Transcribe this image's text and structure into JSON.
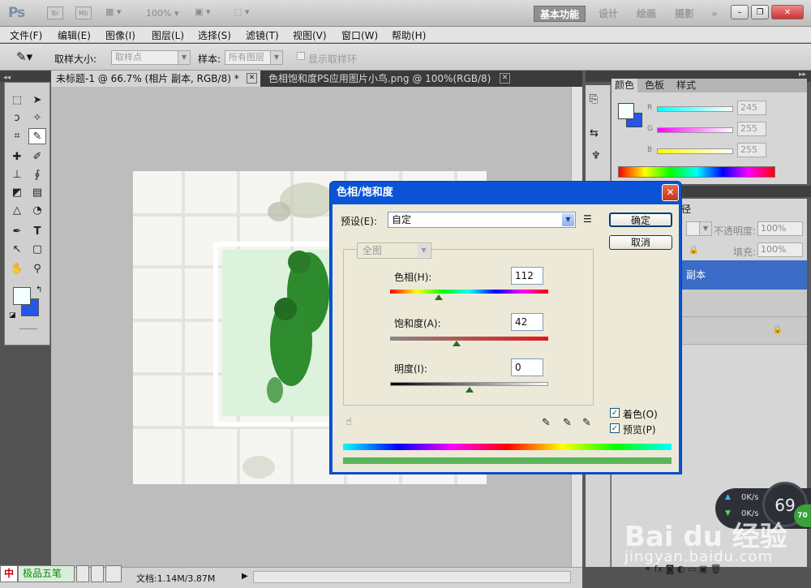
{
  "app": {
    "logo": "Ps"
  },
  "titlebar": {
    "zoom": "100%",
    "workspaces": [
      "基本功能",
      "设计",
      "绘画",
      "摄影"
    ],
    "more": "»",
    "small_icons": [
      "Br",
      "Mb"
    ]
  },
  "menu": [
    "文件(F)",
    "编辑(E)",
    "图像(I)",
    "图层(L)",
    "选择(S)",
    "滤镜(T)",
    "视图(V)",
    "窗口(W)",
    "帮助(H)"
  ],
  "options": {
    "sample_size_label": "取样大小:",
    "sample_size_value": "取样点",
    "sample_label": "样本:",
    "sample_value": "所有图层",
    "show_ring": "显示取样环"
  },
  "tabs": [
    {
      "label": "未标题-1 @ 66.7% (相片 副本, RGB/8) *",
      "active": true
    },
    {
      "label": "色相饱和度PS应用图片小鸟.png @ 100%(RGB/8)",
      "active": false
    }
  ],
  "color_panel": {
    "tabs": [
      "颜色",
      "色板",
      "样式"
    ],
    "channels": [
      {
        "name": "R",
        "value": "245"
      },
      {
        "name": "G",
        "value": "255"
      },
      {
        "name": "B",
        "value": "255"
      }
    ]
  },
  "layers_panel": {
    "opacity_label": "不透明度:",
    "opacity_value": "100%",
    "fill_label": "填充:",
    "fill_value": "100%",
    "layer_name": "副本",
    "tab_fragment": "径"
  },
  "dialog": {
    "title": "色相/饱和度",
    "preset_label": "预设(E):",
    "preset_value": "自定",
    "channel_value": "全图",
    "ok": "确定",
    "cancel": "取消",
    "hue_label": "色相(H):",
    "hue_value": "112",
    "saturation_label": "饱和度(A):",
    "saturation_value": "42",
    "lightness_label": "明度(I):",
    "lightness_value": "0",
    "colorize_label": "着色(O)",
    "preview_label": "预览(P)",
    "hue_pos": 0.31,
    "sat_pos": 0.42,
    "light_pos": 0.5
  },
  "status": {
    "doc_info": "文档:1.14M/3.87M",
    "ime_name": "极品五笔",
    "ime_char": "中"
  },
  "netmon": {
    "up": "0K/s",
    "down": "0K/s",
    "value": "69",
    "badge": "70"
  },
  "watermark": {
    "text": "Bai du 经验",
    "url": "jingyan.baidu.com"
  }
}
